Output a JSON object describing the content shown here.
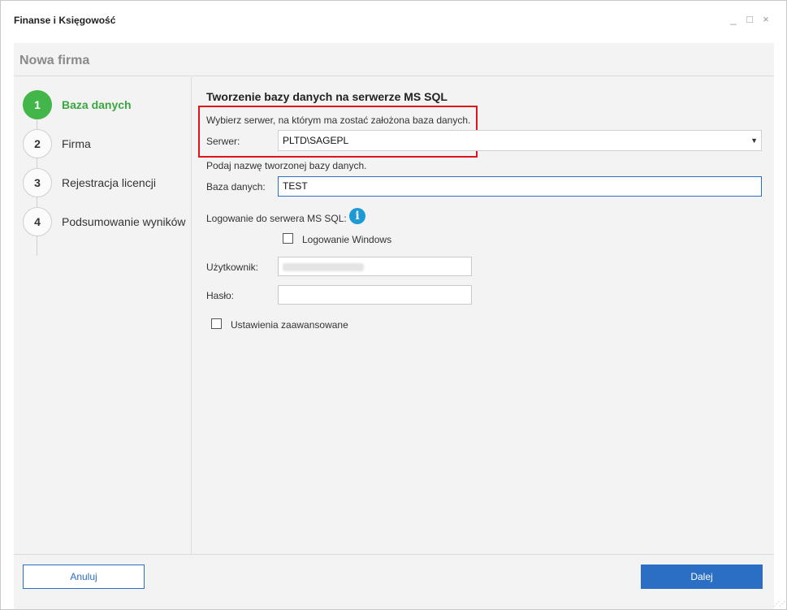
{
  "window": {
    "title": "Finanse i Księgowość",
    "controls": {
      "minimize": "_",
      "maximize": "□",
      "close": "×"
    }
  },
  "wizard": {
    "title": "Nowa firma",
    "steps": [
      {
        "number": "1",
        "label": "Baza danych",
        "active": true
      },
      {
        "number": "2",
        "label": "Firma",
        "active": false
      },
      {
        "number": "3",
        "label": "Rejestracja licencji",
        "active": false
      },
      {
        "number": "4",
        "label": "Podsumowanie wyników",
        "active": false
      }
    ]
  },
  "form": {
    "section_title": "Tworzenie bazy danych na serwerze MS SQL",
    "server_hint": "Wybierz serwer, na którym ma zostać założona baza danych.",
    "server_label": "Serwer:",
    "server_value": "PLTD\\SAGEPL",
    "db_hint": "Podaj nazwę tworzonej bazy danych.",
    "db_label": "Baza danych:",
    "db_value": "TEST",
    "login_label": "Logowanie do serwera MS SQL:",
    "info_icon": "i",
    "windows_login_label": "Logowanie Windows",
    "windows_login_checked": false,
    "user_label": "Użytkownik:",
    "password_label": "Hasło:",
    "password_value": "",
    "advanced_label": "Ustawienia zaawansowane",
    "advanced_checked": false
  },
  "footer": {
    "cancel_label": "Anuluj",
    "next_label": "Dalej"
  },
  "colors": {
    "accent": "#2a6fc4",
    "active_step": "#43b649",
    "highlight": "#e0141b",
    "info": "#1b9ad6"
  }
}
